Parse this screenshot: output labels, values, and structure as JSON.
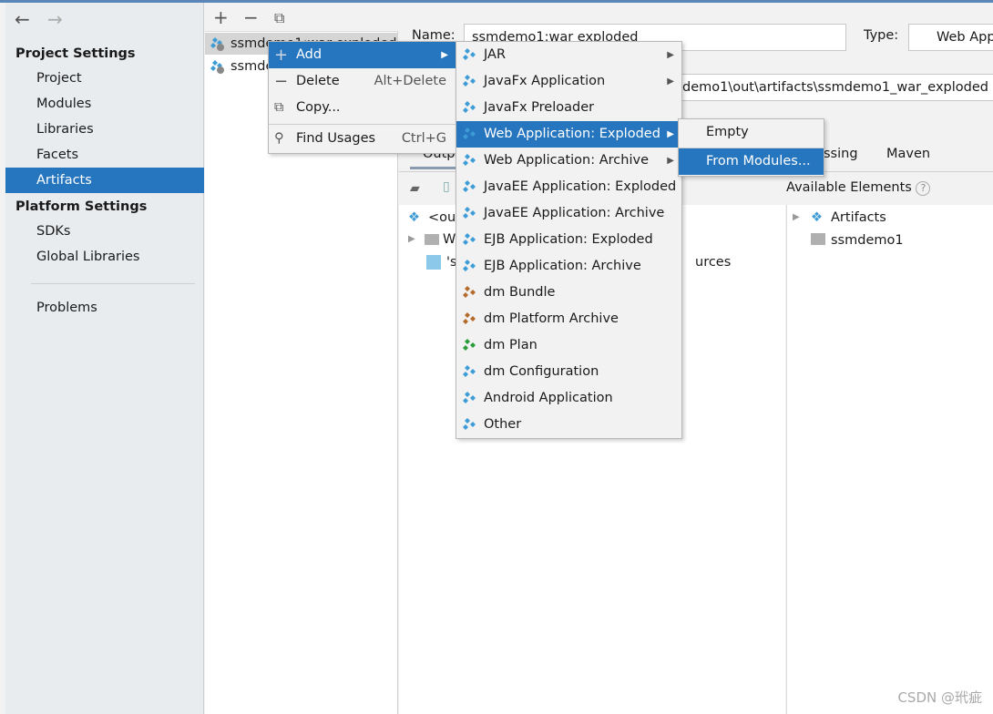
{
  "sidebar": {
    "project_settings": "Project Settings",
    "items": [
      {
        "label": "Project"
      },
      {
        "label": "Modules"
      },
      {
        "label": "Libraries"
      },
      {
        "label": "Facets"
      },
      {
        "label": "Artifacts"
      }
    ],
    "platform_settings": "Platform Settings",
    "platform_items": [
      {
        "label": "SDKs"
      },
      {
        "label": "Global Libraries"
      }
    ],
    "problems": "Problems",
    "selected": "Artifacts"
  },
  "artifacts": [
    {
      "label": "ssmdemo1:war exploded"
    },
    {
      "label": "ssmde"
    }
  ],
  "form": {
    "name_label": "Name:",
    "name_value": "ssmdemo1:war exploded",
    "type_label": "Type:",
    "type_value": "Web App",
    "output_dir": "demo1\\out\\artifacts\\ssmdemo1_war_exploded",
    "tabs": [
      "Outp",
      "ssing",
      "Maven"
    ],
    "available_elements": "Available Elements",
    "layout_tree": [
      {
        "label": "<out"
      },
      {
        "label": "W"
      },
      {
        "label": "'s",
        "tail": "urces"
      }
    ],
    "available_tree": [
      {
        "label": "Artifacts"
      },
      {
        "label": "ssmdemo1"
      }
    ]
  },
  "context_menu": [
    {
      "label": "Add",
      "shortcut": "",
      "icon": "plus-icon"
    },
    {
      "label": "Delete",
      "shortcut": "Alt+Delete",
      "icon": "minus-icon"
    },
    {
      "label": "Copy...",
      "shortcut": "",
      "icon": "copy-icon"
    },
    {
      "label": "Find Usages",
      "shortcut": "Ctrl+G",
      "icon": "search-icon"
    }
  ],
  "add_submenu": [
    {
      "label": "JAR",
      "arrow": true
    },
    {
      "label": "JavaFx Application",
      "arrow": true
    },
    {
      "label": "JavaFx Preloader",
      "arrow": false
    },
    {
      "label": "Web Application: Exploded",
      "arrow": true
    },
    {
      "label": "Web Application: Archive",
      "arrow": true
    },
    {
      "label": "JavaEE Application: Exploded",
      "arrow": false
    },
    {
      "label": "JavaEE Application: Archive",
      "arrow": false
    },
    {
      "label": "EJB Application: Exploded",
      "arrow": false
    },
    {
      "label": "EJB Application: Archive",
      "arrow": false
    },
    {
      "label": "dm Bundle",
      "arrow": false
    },
    {
      "label": "dm Platform Archive",
      "arrow": false
    },
    {
      "label": "dm Plan",
      "arrow": false
    },
    {
      "label": "dm Configuration",
      "arrow": false
    },
    {
      "label": "Android Application",
      "arrow": false
    },
    {
      "label": "Other",
      "arrow": false
    }
  ],
  "web_submenu": [
    {
      "label": "Empty"
    },
    {
      "label": "From Modules..."
    }
  ],
  "watermark": "CSDN @玳疵",
  "colors": {
    "accent": "#2675bf",
    "sidebar_bg": "#e9ecef",
    "icon_blue": "#3d9bd6"
  }
}
